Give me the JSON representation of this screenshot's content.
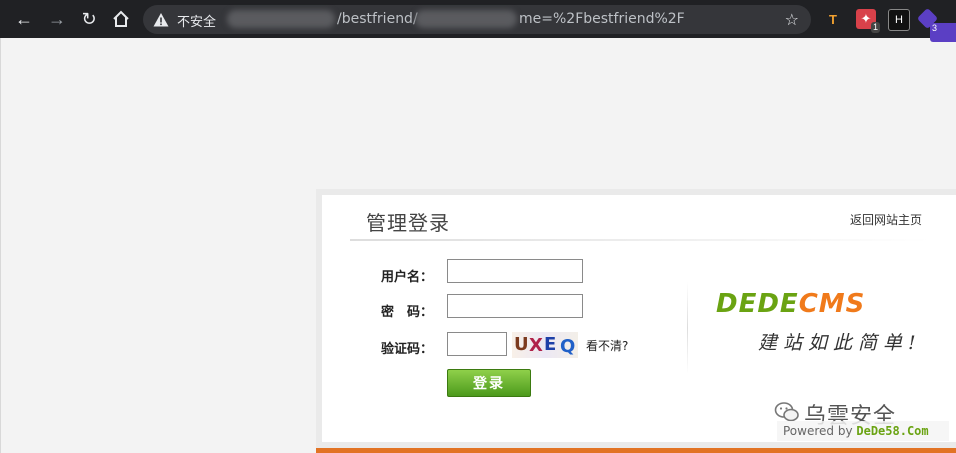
{
  "browser": {
    "security_label": "不安全",
    "url_part_1": "/bestfriend/",
    "url_part_2": "me=%2Fbestfriend%2F",
    "extensions": [
      {
        "name": "translate-ext",
        "badge": ""
      },
      {
        "name": "ext-2",
        "badge": "1"
      },
      {
        "name": "ext-3",
        "badge": ""
      },
      {
        "name": "ext-4",
        "badge": "3"
      }
    ]
  },
  "login": {
    "title": "管理登录",
    "back_link": "返回网站主页",
    "username_label": "用户名：",
    "password_label": "密　码：",
    "captcha_label": "验证码：",
    "username_value": "",
    "password_value": "",
    "captcha_value": "",
    "captcha_chars": [
      "U",
      "X",
      "E",
      "Q"
    ],
    "refresh_label": "看不清?",
    "submit_label": "登录"
  },
  "brand": {
    "logo_part_1": "DEDE",
    "logo_part_2": "CMS",
    "slogan": "建站如此简单!",
    "powered_prefix": "Powered by ",
    "powered_name": "DeDe58.Com"
  },
  "watermark": {
    "text": "乌雲安全"
  },
  "colors": {
    "chrome_bg": "#202124",
    "accent_orange": "#e27324",
    "button_green": "#4c9a1c",
    "logo_green": "#6aa312",
    "logo_orange": "#f07a1b"
  }
}
